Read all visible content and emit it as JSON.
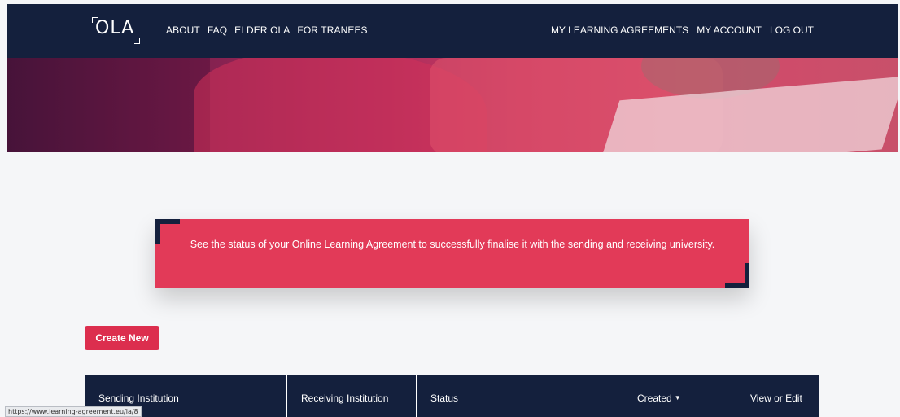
{
  "navbar": {
    "logo_text": "OLA",
    "left_links": [
      "ABOUT",
      "FAQ",
      "ELDER OLA",
      "FOR TRANEES"
    ],
    "right_links": [
      "MY LEARNING AGREEMENTS",
      "MY ACCOUNT",
      "LOG OUT"
    ]
  },
  "info": {
    "text": "See the status of your Online Learning Agreement to successfully finalise it with the sending and receiving university."
  },
  "actions": {
    "create_new_label": "Create New"
  },
  "table": {
    "headers": [
      "Sending Institution",
      "Receiving Institution",
      "Status",
      "Created",
      "View or Edit"
    ]
  },
  "status_bar": {
    "url": "https://www.learning-agreement.eu/la/8"
  },
  "colors": {
    "navy": "#14203d",
    "accent_red": "#e23a58",
    "button_red": "#dc2e4e"
  },
  "icons": {
    "sort": "caret-down-icon"
  }
}
